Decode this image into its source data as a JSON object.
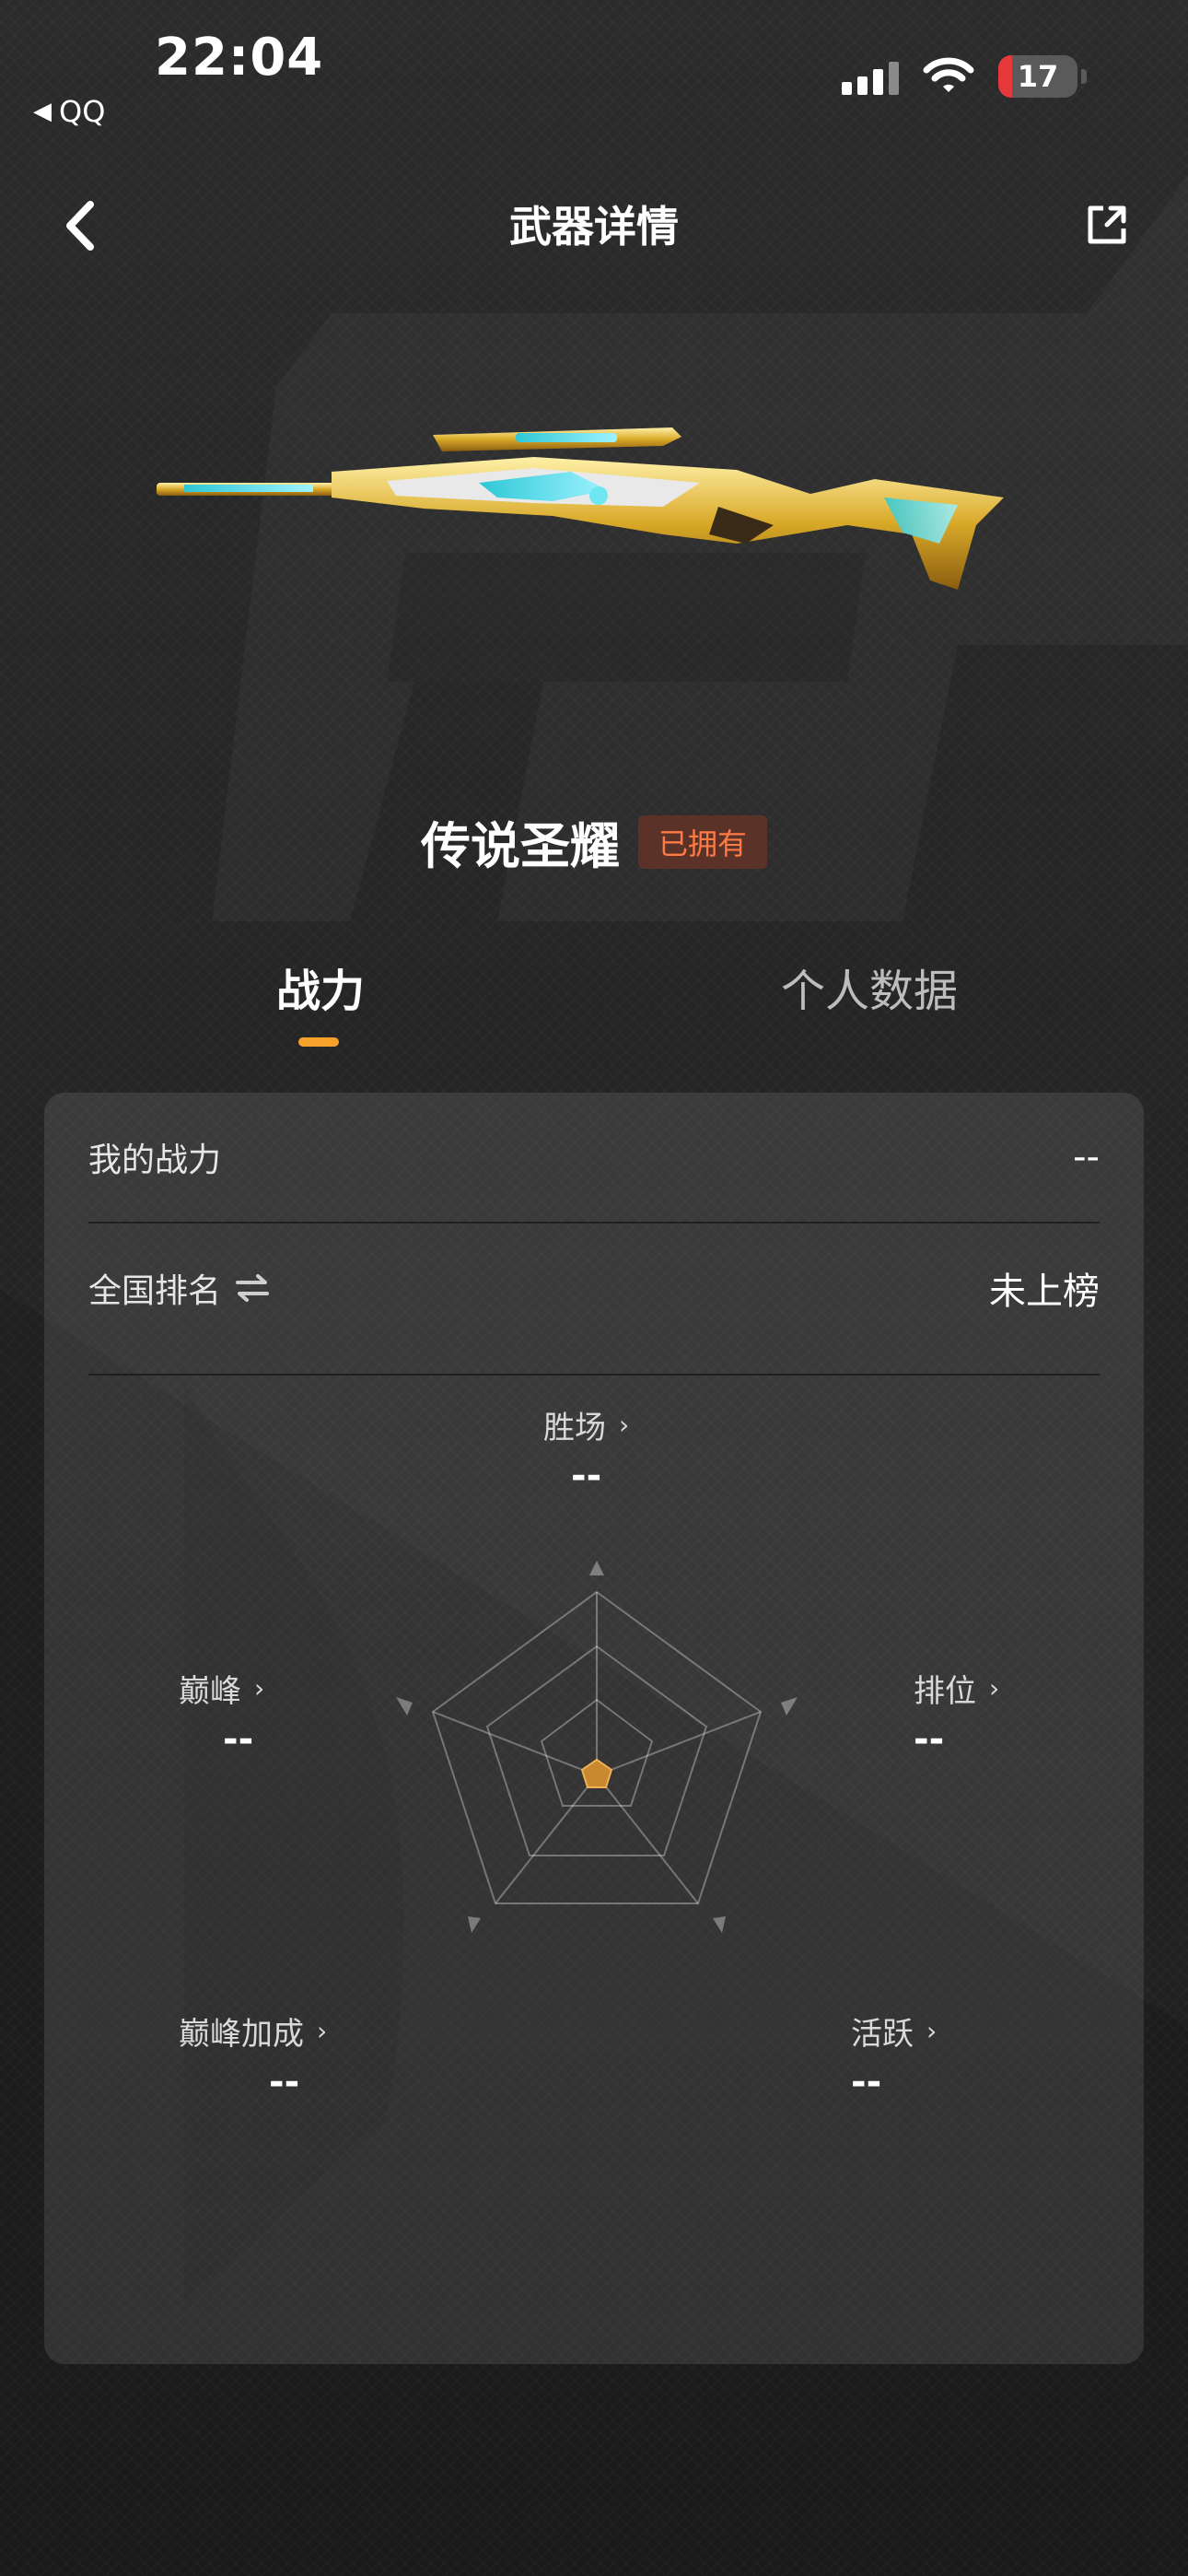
{
  "status_bar": {
    "time": "22:04",
    "back_app": "QQ",
    "battery_level": "17",
    "battery_color": "#e5383b"
  },
  "nav": {
    "title": "武器详情",
    "back_icon": "chevron-left-icon",
    "share_icon": "external-share-icon"
  },
  "weapon": {
    "name": "传说圣耀",
    "owned_badge": "已拥有"
  },
  "tabs": [
    {
      "label": "战力",
      "active": true
    },
    {
      "label": "个人数据",
      "active": false
    }
  ],
  "accent_color": "#f5a12a",
  "card": {
    "my_power": {
      "label": "我的战力",
      "value": "--"
    },
    "national_rank": {
      "label": "全国排名",
      "value": "未上榜",
      "icon": "swap-arrows-icon"
    },
    "stats": {
      "wins": {
        "label": "胜场",
        "value": "--"
      },
      "ranked": {
        "label": "排位",
        "value": "--"
      },
      "active": {
        "label": "活跃",
        "value": "--"
      },
      "peak_bonus": {
        "label": "巅峰加成",
        "value": "--"
      },
      "peak": {
        "label": "巅峰",
        "value": "--"
      }
    }
  }
}
